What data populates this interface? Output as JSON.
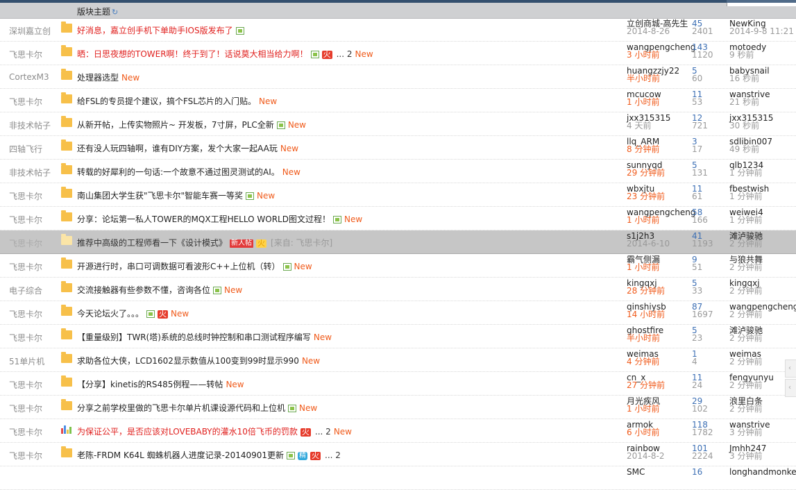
{
  "header": {
    "title": "版块主题",
    "refresh_icon": "refresh-icon"
  },
  "rows": [
    {
      "forum": "深圳嘉立创",
      "icon": "folder",
      "title": "好消息，嘉立创手机下单助手IOS版发布了",
      "red": true,
      "attach": true,
      "hot": "",
      "jing": false,
      "newbie": false,
      "pages": "",
      "is_new": false,
      "from": "",
      "author": "立创商城-高先生",
      "date": "2014-8-26",
      "date_red": false,
      "replies": "45",
      "views": "2401",
      "last_user": "NewKing",
      "last_time": "2014-9-8 11:21"
    },
    {
      "forum": "飞思卡尔",
      "icon": "folder",
      "title": "晒：日思夜想的TOWER啊！终于到了！话说莫大相当给力啊！",
      "red": true,
      "attach": true,
      "hot": "火",
      "jing": false,
      "newbie": false,
      "pages": "... 2",
      "is_new": true,
      "from": "",
      "author": "wangpengcheng",
      "date": "3 小时前",
      "date_red": true,
      "replies": "143",
      "views": "1120",
      "last_user": "motoedy",
      "last_time": "9 秒前"
    },
    {
      "forum": "CortexM3",
      "icon": "folder",
      "title": "处理器选型",
      "red": false,
      "attach": false,
      "hot": "",
      "jing": false,
      "newbie": false,
      "pages": "",
      "is_new": true,
      "from": "",
      "author": "huangzzjy22",
      "date": "半小时前",
      "date_red": true,
      "replies": "5",
      "views": "60",
      "last_user": "babysnail",
      "last_time": "16 秒前"
    },
    {
      "forum": "飞思卡尔",
      "icon": "folder",
      "title": "给FSL的专员提个建议，搞个FSL芯片的入门贴。",
      "red": false,
      "attach": false,
      "hot": "",
      "jing": false,
      "newbie": false,
      "pages": "",
      "is_new": true,
      "from": "",
      "author": "mcucow",
      "date": "1 小时前",
      "date_red": true,
      "replies": "11",
      "views": "53",
      "last_user": "wanstrive",
      "last_time": "21 秒前"
    },
    {
      "forum": "非技术帖子",
      "icon": "folder",
      "title": "从新开帖，上传实物照片~ 开发板，7寸屏，PLC全新",
      "red": false,
      "attach": true,
      "hot": "",
      "jing": false,
      "newbie": false,
      "pages": "",
      "is_new": true,
      "from": "",
      "author": "jxx315315",
      "date": "4 天前",
      "date_red": false,
      "replies": "12",
      "views": "721",
      "last_user": "jxx315315",
      "last_time": "30 秒前"
    },
    {
      "forum": "四轴飞行",
      "icon": "folder",
      "title": "还有没人玩四轴啊，谁有DIY方案，发个大家一起AA玩",
      "red": false,
      "attach": false,
      "hot": "",
      "jing": false,
      "newbie": false,
      "pages": "",
      "is_new": true,
      "from": "",
      "author": "llq_ARM",
      "date": "8 分钟前",
      "date_red": true,
      "replies": "3",
      "views": "17",
      "last_user": "sdlibin007",
      "last_time": "49 秒前"
    },
    {
      "forum": "非技术帖子",
      "icon": "folder",
      "title": "转载的好犀利的一句话:一个故意不通过图灵测试的AI。",
      "red": false,
      "attach": false,
      "hot": "",
      "jing": false,
      "newbie": false,
      "pages": "",
      "is_new": true,
      "from": "",
      "author": "sunnyqd",
      "date": "29 分钟前",
      "date_red": true,
      "replies": "5",
      "views": "131",
      "last_user": "qlb1234",
      "last_time": "1 分钟前"
    },
    {
      "forum": "飞思卡尔",
      "icon": "folder",
      "title": "南山集团大学生获\"飞思卡尔\"智能车赛一等奖",
      "red": false,
      "attach": true,
      "hot": "",
      "jing": false,
      "newbie": false,
      "pages": "",
      "is_new": true,
      "from": "",
      "author": "wbxjtu",
      "date": "23 分钟前",
      "date_red": true,
      "replies": "11",
      "views": "61",
      "last_user": "fbestwish",
      "last_time": "1 分钟前"
    },
    {
      "forum": "飞思卡尔",
      "icon": "folder",
      "title": "分享：论坛第一私人TOWER的MQX工程HELLO WORLD图文过程！",
      "red": false,
      "attach": true,
      "hot": "",
      "jing": false,
      "newbie": false,
      "pages": "",
      "is_new": true,
      "from": "",
      "author": "wangpengcheng",
      "date": "1 小时前",
      "date_red": true,
      "replies": "58",
      "views": "166",
      "last_user": "weiwei4",
      "last_time": "1 分钟前"
    },
    {
      "forum": "飞思卡尔",
      "icon": "folder-light",
      "title": "推荐中高级的工程师看一下《设计模式》",
      "red": false,
      "attach": false,
      "hot": "火",
      "jing": false,
      "newbie": true,
      "pages": "",
      "is_new": false,
      "from": "[来自: 飞思卡尔]",
      "author": "s1j2h3",
      "date": "2014-6-10",
      "date_red": false,
      "replies": "41",
      "views": "1193",
      "last_user": "滩泸骏驰",
      "last_time": "2 分钟前",
      "highlight": true
    },
    {
      "forum": "飞思卡尔",
      "icon": "folder",
      "title": "开源进行时，串口可调数据可看波形C++上位机（转）",
      "red": false,
      "attach": true,
      "hot": "",
      "jing": false,
      "newbie": false,
      "pages": "",
      "is_new": true,
      "from": "",
      "author": "霸气侧漏",
      "date": "1 小时前",
      "date_red": true,
      "replies": "9",
      "views": "51",
      "last_user": "与狼共舞",
      "last_time": "2 分钟前"
    },
    {
      "forum": "电子综合",
      "icon": "folder",
      "title": "交流接触器有些参数不懂，咨询各位",
      "red": false,
      "attach": true,
      "hot": "",
      "jing": false,
      "newbie": false,
      "pages": "",
      "is_new": true,
      "from": "",
      "author": "kingqxj",
      "date": "28 分钟前",
      "date_red": true,
      "replies": "5",
      "views": "33",
      "last_user": "kingqxj",
      "last_time": "2 分钟前"
    },
    {
      "forum": "飞思卡尔",
      "icon": "folder",
      "title": "今天论坛火了。。。",
      "red": false,
      "attach": true,
      "hot": "火",
      "jing": false,
      "newbie": false,
      "pages": "",
      "is_new": true,
      "from": "",
      "author": "qinshiysb",
      "date": "14 小时前",
      "date_red": true,
      "replies": "87",
      "views": "1697",
      "last_user": "wangpengcheng",
      "last_time": "2 分钟前"
    },
    {
      "forum": "飞思卡尔",
      "icon": "folder",
      "title": "【重量级别】TWR(塔)系统的总线时钟控制和串口测试程序编写",
      "red": false,
      "attach": false,
      "hot": "",
      "jing": false,
      "newbie": false,
      "pages": "",
      "is_new": true,
      "from": "",
      "author": "ghostfire",
      "date": "半小时前",
      "date_red": true,
      "replies": "5",
      "views": "23",
      "last_user": "滩泸骏驰",
      "last_time": "2 分钟前"
    },
    {
      "forum": "51单片机",
      "icon": "folder",
      "title": "求助各位大侠，LCD1602显示数值从100变到99时显示990",
      "red": false,
      "attach": false,
      "hot": "",
      "jing": false,
      "newbie": false,
      "pages": "",
      "is_new": true,
      "from": "",
      "author": "weimas",
      "date": "4 分钟前",
      "date_red": true,
      "replies": "1",
      "views": "4",
      "last_user": "weimas",
      "last_time": "2 分钟前"
    },
    {
      "forum": "飞思卡尔",
      "icon": "folder",
      "title": "【分享】kinetis的RS485例程——转帖",
      "red": false,
      "attach": false,
      "hot": "",
      "jing": false,
      "newbie": false,
      "pages": "",
      "is_new": true,
      "from": "",
      "author": "cn_x",
      "date": "27 分钟前",
      "date_red": true,
      "replies": "11",
      "views": "24",
      "last_user": "fengyunyu",
      "last_time": "2 分钟前"
    },
    {
      "forum": "飞思卡尔",
      "icon": "folder",
      "title": "分享之前学校里做的飞思卡尔单片机课设源代码和上位机",
      "red": false,
      "attach": true,
      "hot": "",
      "jing": false,
      "newbie": false,
      "pages": "",
      "is_new": true,
      "from": "",
      "author": "月光疾风",
      "date": "1 小时前",
      "date_red": true,
      "replies": "29",
      "views": "102",
      "last_user": "浪里白条",
      "last_time": "2 分钟前"
    },
    {
      "forum": "飞思卡尔",
      "icon": "poll",
      "title": "为保证公平，是否应该对LOVEBABY的灌水10倍飞币的罚款",
      "red": true,
      "attach": false,
      "hot": "火",
      "jing": false,
      "newbie": false,
      "pages": "... 2",
      "is_new": true,
      "from": "",
      "author": "armok",
      "date": "6 小时前",
      "date_red": true,
      "replies": "118",
      "views": "1782",
      "last_user": "wanstrive",
      "last_time": "3 分钟前"
    },
    {
      "forum": "飞思卡尔",
      "icon": "folder",
      "title": "老陈-FRDM K64L 蜘蛛机器人进度记录-20140901更新",
      "red": false,
      "attach": true,
      "hot": "火",
      "jing": true,
      "newbie": false,
      "pages": "... 2",
      "is_new": false,
      "from": "",
      "author": "rainbow",
      "date": "2014-8-2",
      "date_red": false,
      "replies": "101",
      "views": "2224",
      "last_user": "Jmhh247",
      "last_time": "3 分钟前"
    },
    {
      "forum": "",
      "icon": "",
      "title": "",
      "red": false,
      "attach": false,
      "hot": "",
      "jing": false,
      "newbie": false,
      "pages": "",
      "is_new": false,
      "from": "",
      "author": "SMC",
      "date": "",
      "date_red": false,
      "replies": "16",
      "views": "",
      "last_user": "longhandmonkey",
      "last_time": ""
    }
  ],
  "labels": {
    "new": "New",
    "hot": "火",
    "jing": "精",
    "newbie": "新人帖"
  }
}
